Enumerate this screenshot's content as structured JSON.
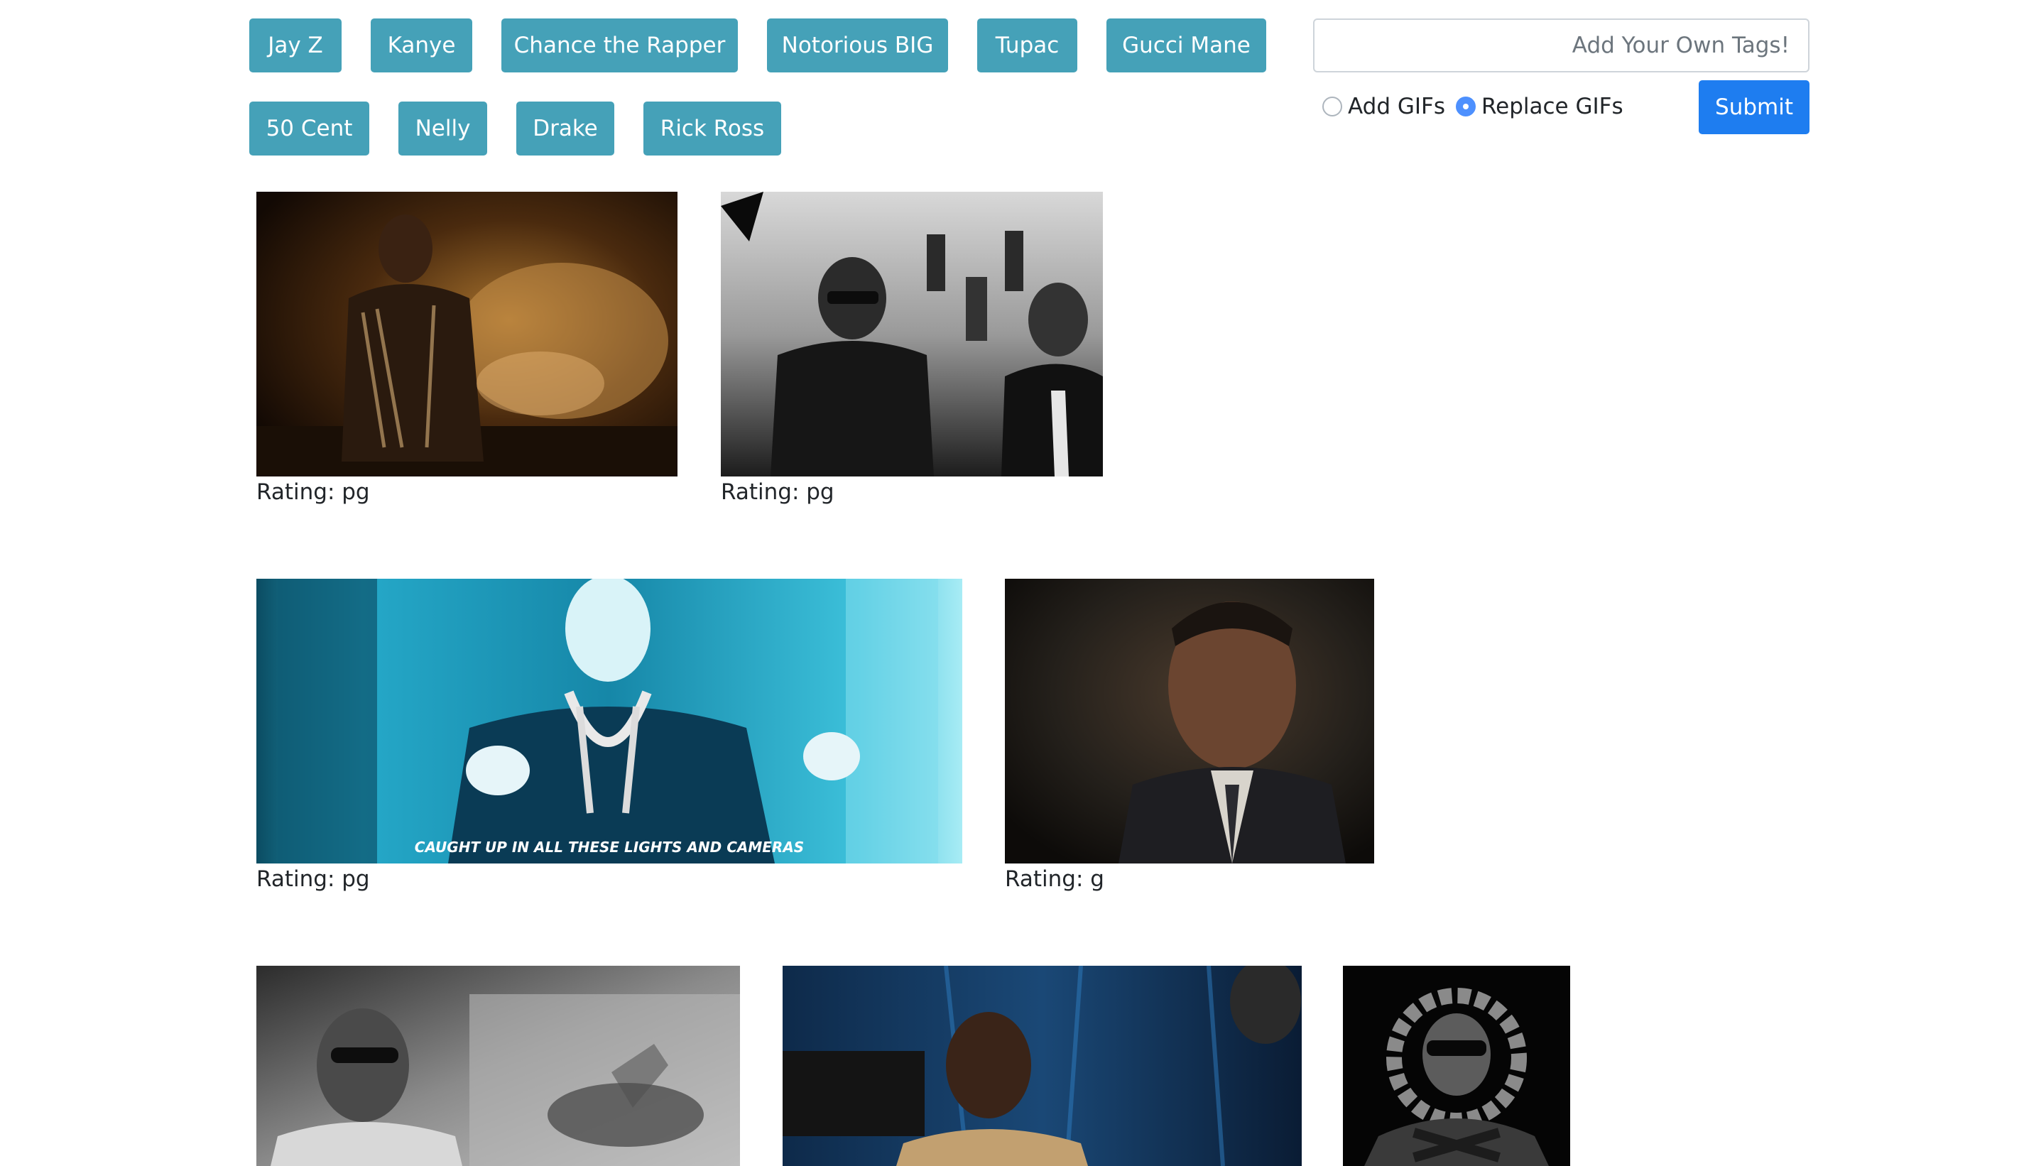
{
  "tag_buttons": [
    "Jay Z",
    "Kanye",
    "Chance the Rapper",
    "Notorious BIG",
    "Tupac",
    "Gucci Mane",
    "50 Cent",
    "Nelly",
    "Drake",
    "Rick Ross"
  ],
  "tag_input": {
    "value": "",
    "placeholder": "Add Your Own Tags!"
  },
  "mode_options": [
    {
      "label": "Add GIFs",
      "selected": false
    },
    {
      "label": "Replace GIFs",
      "selected": true
    }
  ],
  "submit_label": "Submit",
  "gifs": [
    {
      "rating": "Rating: pg"
    },
    {
      "rating": "Rating: pg"
    },
    {
      "rating": "Rating: pg",
      "caption": "CAUGHT UP IN ALL THESE LIGHTS AND CAMERAS"
    },
    {
      "rating": "Rating: g"
    },
    {
      "rating": ""
    },
    {
      "rating": ""
    },
    {
      "rating": ""
    }
  ],
  "colors": {
    "tag_button": "#45a1b8",
    "submit_button": "#1e7df0",
    "radio_selected": "#4d90fe"
  }
}
